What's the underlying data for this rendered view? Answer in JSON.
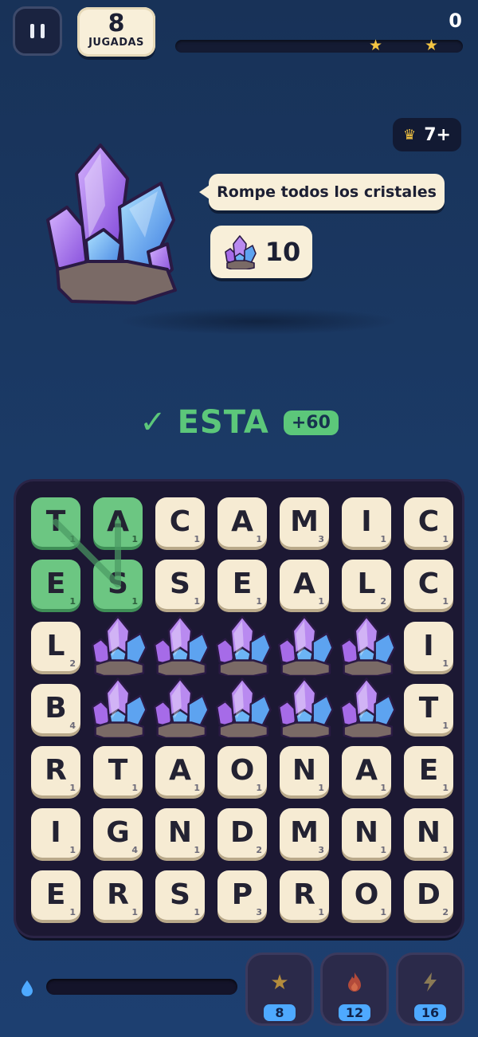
{
  "topbar": {
    "moves_value": "8",
    "moves_label": "JUGADAS",
    "score": "0",
    "progress": 0,
    "stars": [
      "star",
      "star"
    ]
  },
  "level_badge": {
    "icon": "crown-icon",
    "text": "7+"
  },
  "objective": {
    "instruction": "Rompe todos los cristales",
    "target_icon": "crystal-icon",
    "target_count": "10"
  },
  "found_word": {
    "icon": "check-icon",
    "word": "ESTA",
    "points": "+60",
    "color": "#5cc77a"
  },
  "board": {
    "rows": 7,
    "cols": 7,
    "cells": [
      [
        {
          "l": "T",
          "p": "1",
          "sel": true
        },
        {
          "l": "A",
          "p": "1",
          "sel": true
        },
        {
          "l": "C",
          "p": "1"
        },
        {
          "l": "A",
          "p": "1"
        },
        {
          "l": "M",
          "p": "3"
        },
        {
          "l": "I",
          "p": "1"
        },
        {
          "l": "C",
          "p": "1"
        }
      ],
      [
        {
          "l": "E",
          "p": "1",
          "sel": true
        },
        {
          "l": "S",
          "p": "1",
          "sel": true
        },
        {
          "l": "S",
          "p": "1"
        },
        {
          "l": "E",
          "p": "1"
        },
        {
          "l": "A",
          "p": "1"
        },
        {
          "l": "L",
          "p": "2"
        },
        {
          "l": "C",
          "p": "1"
        }
      ],
      [
        {
          "l": "L",
          "p": "2"
        },
        {
          "crystal": true
        },
        {
          "crystal": true
        },
        {
          "crystal": true
        },
        {
          "crystal": true
        },
        {
          "crystal": true
        },
        {
          "l": "I",
          "p": "1"
        }
      ],
      [
        {
          "l": "B",
          "p": "4"
        },
        {
          "crystal": true
        },
        {
          "crystal": true
        },
        {
          "crystal": true
        },
        {
          "crystal": true
        },
        {
          "crystal": true
        },
        {
          "l": "T",
          "p": "1"
        }
      ],
      [
        {
          "l": "R",
          "p": "1"
        },
        {
          "l": "T",
          "p": "1"
        },
        {
          "l": "A",
          "p": "1"
        },
        {
          "l": "O",
          "p": "1"
        },
        {
          "l": "N",
          "p": "1"
        },
        {
          "l": "A",
          "p": "1"
        },
        {
          "l": "E",
          "p": "1"
        }
      ],
      [
        {
          "l": "I",
          "p": "1"
        },
        {
          "l": "G",
          "p": "4"
        },
        {
          "l": "N",
          "p": "1"
        },
        {
          "l": "D",
          "p": "2"
        },
        {
          "l": "M",
          "p": "3"
        },
        {
          "l": "N",
          "p": "1"
        },
        {
          "l": "N",
          "p": "1"
        }
      ],
      [
        {
          "l": "E",
          "p": "1"
        },
        {
          "l": "R",
          "p": "1"
        },
        {
          "l": "S",
          "p": "1"
        },
        {
          "l": "P",
          "p": "3"
        },
        {
          "l": "R",
          "p": "1"
        },
        {
          "l": "O",
          "p": "1"
        },
        {
          "l": "D",
          "p": "2"
        }
      ]
    ],
    "selected_path": [
      [
        0,
        0
      ],
      [
        1,
        1
      ],
      [
        0,
        1
      ]
    ]
  },
  "bottom": {
    "meter_icon": "water-drop-icon",
    "meter_level": 0,
    "powerups": [
      {
        "icon": "star-icon",
        "count": "8"
      },
      {
        "icon": "fire-icon",
        "count": "12"
      },
      {
        "icon": "lightning-icon",
        "count": "16"
      }
    ]
  },
  "colors": {
    "background": "#1b3a66",
    "tile": "#f6ebd3",
    "selected_tile": "#6cc682",
    "accent": "#4ea9ff",
    "star": "#f4c542"
  }
}
